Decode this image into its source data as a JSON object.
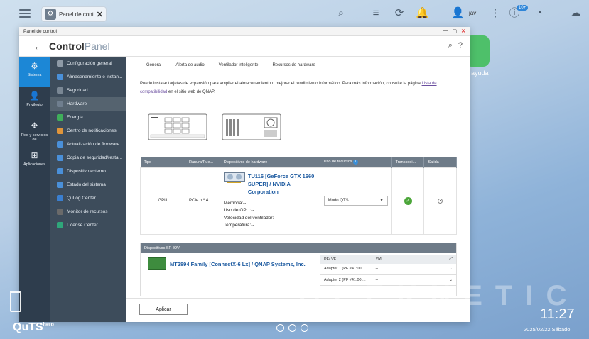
{
  "desktop": {
    "tab_label": "Panel de control",
    "user": "jav",
    "notif_badge": "10+",
    "help_label": "ayuda",
    "clock": "11:27",
    "date": "2025/02/22 Sábado",
    "brand": "QuTS",
    "brand_sup": "hero",
    "watermark": "GEEKNETIC"
  },
  "window": {
    "title": "Panel de control",
    "header_title_1": "Control",
    "header_title_2": "Panel"
  },
  "categories": [
    {
      "label": "Sistema",
      "icon": "gear-icon"
    },
    {
      "label": "Privilegio",
      "icon": "user-icon"
    },
    {
      "label": "Red y servicios de",
      "icon": "network-icon"
    },
    {
      "label": "Aplicaciones",
      "icon": "apps-icon"
    }
  ],
  "menu": [
    {
      "label": "Configuración general",
      "color": "#8e9aa6"
    },
    {
      "label": "Almacenamiento e instan...",
      "color": "#4a90d9"
    },
    {
      "label": "Seguridad",
      "color": "#7a8794"
    },
    {
      "label": "Hardware",
      "color": "#6f7e8e"
    },
    {
      "label": "Energía",
      "color": "#3fae5a"
    },
    {
      "label": "Centro de notificaciones",
      "color": "#e0953a"
    },
    {
      "label": "Actualización de firmware",
      "color": "#4a90d9"
    },
    {
      "label": "Copia de seguridad/resta...",
      "color": "#4a90d9"
    },
    {
      "label": "Dispositivo externo",
      "color": "#4a90d9"
    },
    {
      "label": "Estado del sistema",
      "color": "#4a90d9"
    },
    {
      "label": "QuLog Center",
      "color": "#3a7fd0"
    },
    {
      "label": "Monitor de recursos",
      "color": "#6a6a6a"
    },
    {
      "label": "License Center",
      "color": "#2fa67a"
    }
  ],
  "tabs": [
    "General",
    "Alerta de audio",
    "Ventilador inteligente",
    "Recursos de hardware"
  ],
  "description": {
    "text": "Puede instalar tarjetas de expansión para ampliar el almacenamiento o mejorar el rendimiento informático. Para más información, consulte la página ",
    "link": "Lista de compatibilidad",
    "suffix": " en el sitio web de QNAP."
  },
  "hw_table": {
    "headers": [
      "Tipo",
      "Ranura/Pue...",
      "Dispositivos de hardware",
      "Uso de recursos",
      "Transcodi...",
      "Salida"
    ],
    "row": {
      "type": "GPU",
      "slot": "PCIe n.º 4",
      "device_name": "TU116 [GeForce GTX 1660 SUPER] / NVIDIA Corporation",
      "memory": "Memoria:--",
      "gpu_usage": "Uso de GPU:--",
      "fan_speed": "Velocidad del ventilador:--",
      "temperature": "Temperatura:--",
      "resource_use": "Modo QTS"
    }
  },
  "sriov": {
    "title": "Dispositivos SR-IOV",
    "device_name": "MT2894 Family [ConnectX-6 Lx] / QNAP Systems, Inc.",
    "headers": [
      "PF/ VF",
      "VM"
    ],
    "rows": [
      {
        "pf": "Adapter 1 (PF #41:00....",
        "vm": "--"
      },
      {
        "pf": "Adapter 2 (PF #41:00....",
        "vm": "--"
      }
    ]
  },
  "footer": {
    "apply": "Aplicar"
  }
}
